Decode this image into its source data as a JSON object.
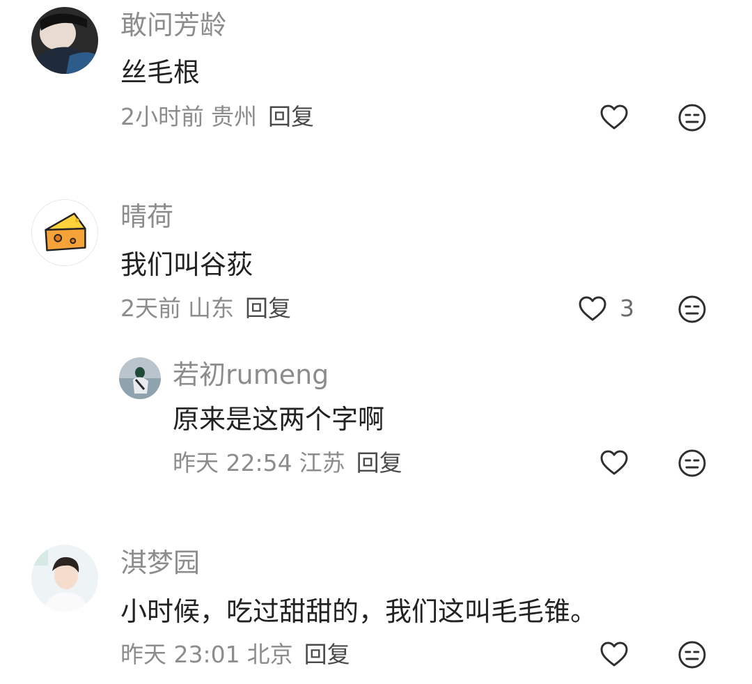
{
  "comments": [
    {
      "username": "敢问芳龄",
      "text": "丝毛根",
      "time": "2小时前",
      "location": "贵州",
      "reply": "回复",
      "likes": ""
    },
    {
      "username": "晴荷",
      "text": "我们叫谷荻",
      "time": "2天前",
      "location": "山东",
      "reply": "回复",
      "likes": "3"
    },
    {
      "username": "若初rumeng",
      "text": "原来是这两个字啊",
      "time": "昨天 22:54",
      "location": "江苏",
      "reply": "回复",
      "likes": ""
    },
    {
      "username": "淇梦园",
      "text": "小时候，吃过甜甜的，我们这叫毛毛锥。",
      "time": "昨天 23:01",
      "location": "北京",
      "reply": "回复",
      "likes": ""
    }
  ],
  "icons": {
    "like": "heart-outline-icon",
    "dislike": "neutral-face-icon"
  }
}
